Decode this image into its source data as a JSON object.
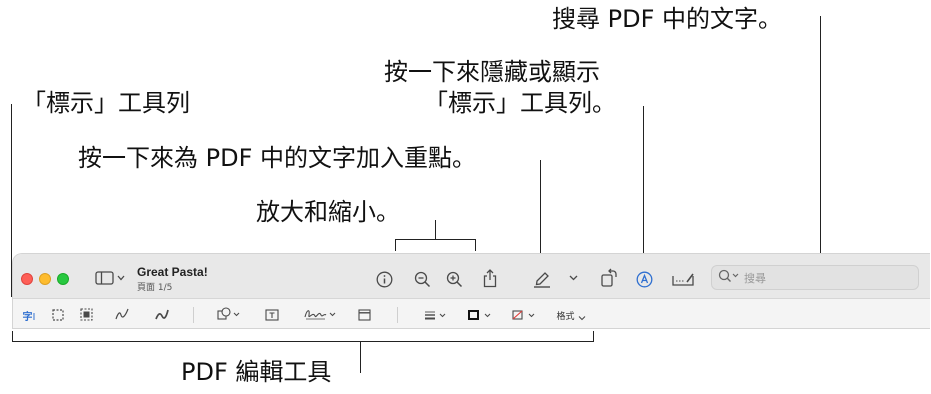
{
  "callouts": {
    "search": "搜尋 PDF 中的文字。",
    "hide_markup_line1": "按一下來隱藏或顯示",
    "hide_markup_line2": "「標示」工具列。",
    "markup_toolbar": "「標示」工具列",
    "highlight": "按一下來為 PDF 中的文字加入重點。",
    "zoom": "放大和縮小。",
    "edit_tools": "PDF 編輯工具"
  },
  "window": {
    "title": "Great Pasta!",
    "page_label": "頁面 1/5",
    "search_placeholder": "搜尋"
  },
  "markup": {
    "text_tool_label": "字",
    "format_label": "格式"
  },
  "colors": {
    "accent": "#2f6fd0",
    "traffic_red": "#fe5f57",
    "traffic_yellow": "#febc2e",
    "traffic_green": "#28c840"
  },
  "icons": [
    "sidebar-icon",
    "info-icon",
    "zoom-out-icon",
    "zoom-in-icon",
    "share-icon",
    "highlight-icon",
    "rotate-icon",
    "markup-icon",
    "form-fill-icon",
    "search-icon",
    "text-selection-icon",
    "rect-selection-icon",
    "smart-lasso-icon",
    "sketch-icon",
    "draw-icon",
    "shapes-icon",
    "text-box-icon",
    "signature-icon",
    "note-icon",
    "shape-style-icon",
    "border-color-icon",
    "fill-color-icon"
  ]
}
